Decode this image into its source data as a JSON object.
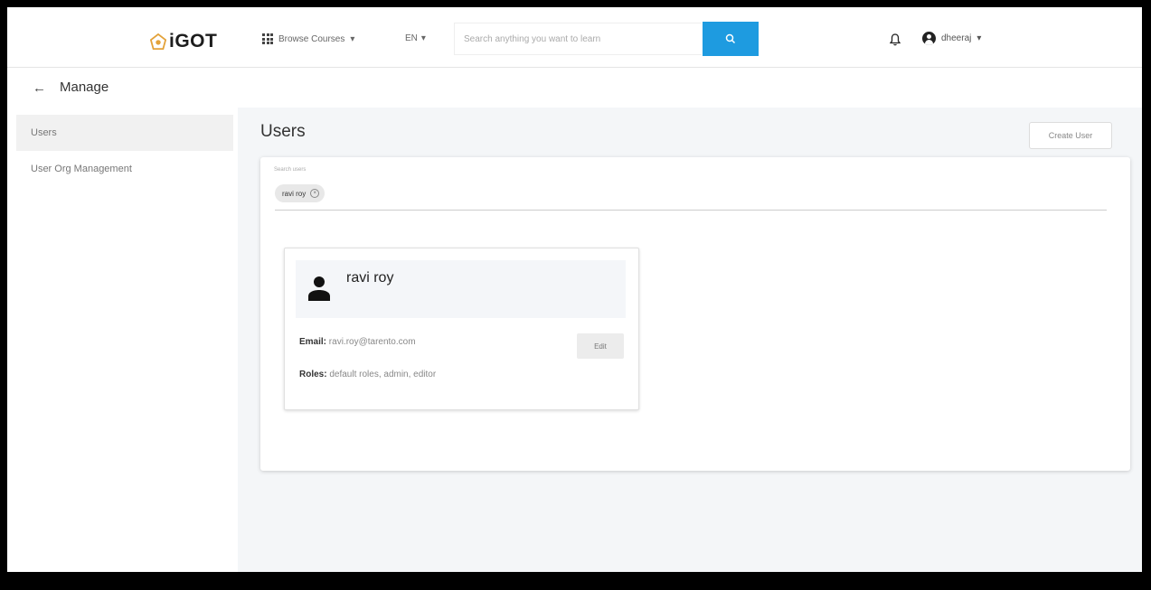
{
  "topbar": {
    "logo_text": "iGOT",
    "browse_label": "Browse Courses",
    "lang_label": "EN",
    "search_placeholder": "Search anything you want to learn",
    "user_label": "dheeraj"
  },
  "manage": {
    "back_icon": "arrow-left-icon",
    "title": "Manage"
  },
  "sidebar": {
    "items": [
      {
        "label": "Users"
      },
      {
        "label": "User Org Management"
      }
    ]
  },
  "main": {
    "title": "Users",
    "create_label": "Create User",
    "search_label": "Search users",
    "chip_value": "ravi roy",
    "user": {
      "name": "ravi roy",
      "email_label": "Email:",
      "email": "ravi.roy@tarento.com",
      "roles_label": "Roles:",
      "roles": "default roles, admin, editor",
      "edit_label": "Edit"
    }
  },
  "colors": {
    "accent": "#1e9be0",
    "background": "#f4f6f8"
  }
}
